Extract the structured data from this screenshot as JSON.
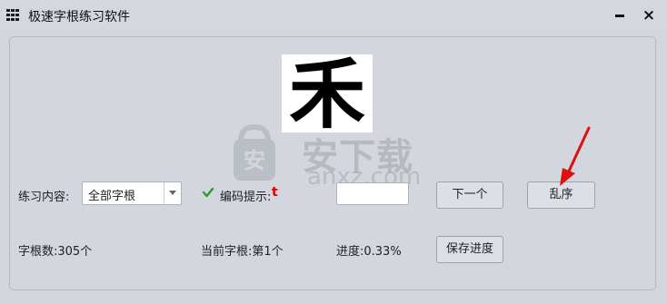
{
  "window": {
    "title": "极速字根练习软件",
    "minimize_icon": "minimize-icon",
    "close_label": "×"
  },
  "practice": {
    "character": "禾",
    "content_label": "练习内容:",
    "content_value": "全部字根",
    "hint_checkbox_checked": true,
    "hint_label": "编码提示:",
    "hint_value": "t",
    "answer_value": "",
    "next_label": "下一个",
    "shuffle_label": "乱序"
  },
  "stats": {
    "root_count": "字根数:305个",
    "current_root": "当前字根:第1个",
    "progress": "进度:0.33%",
    "save_label": "保存进度"
  },
  "watermark": {
    "brand": "安下载",
    "domain": "anxz.com"
  },
  "colors": {
    "hint": "#e00000",
    "annotation_arrow": "#e01010",
    "check": "#2a9a2a"
  }
}
